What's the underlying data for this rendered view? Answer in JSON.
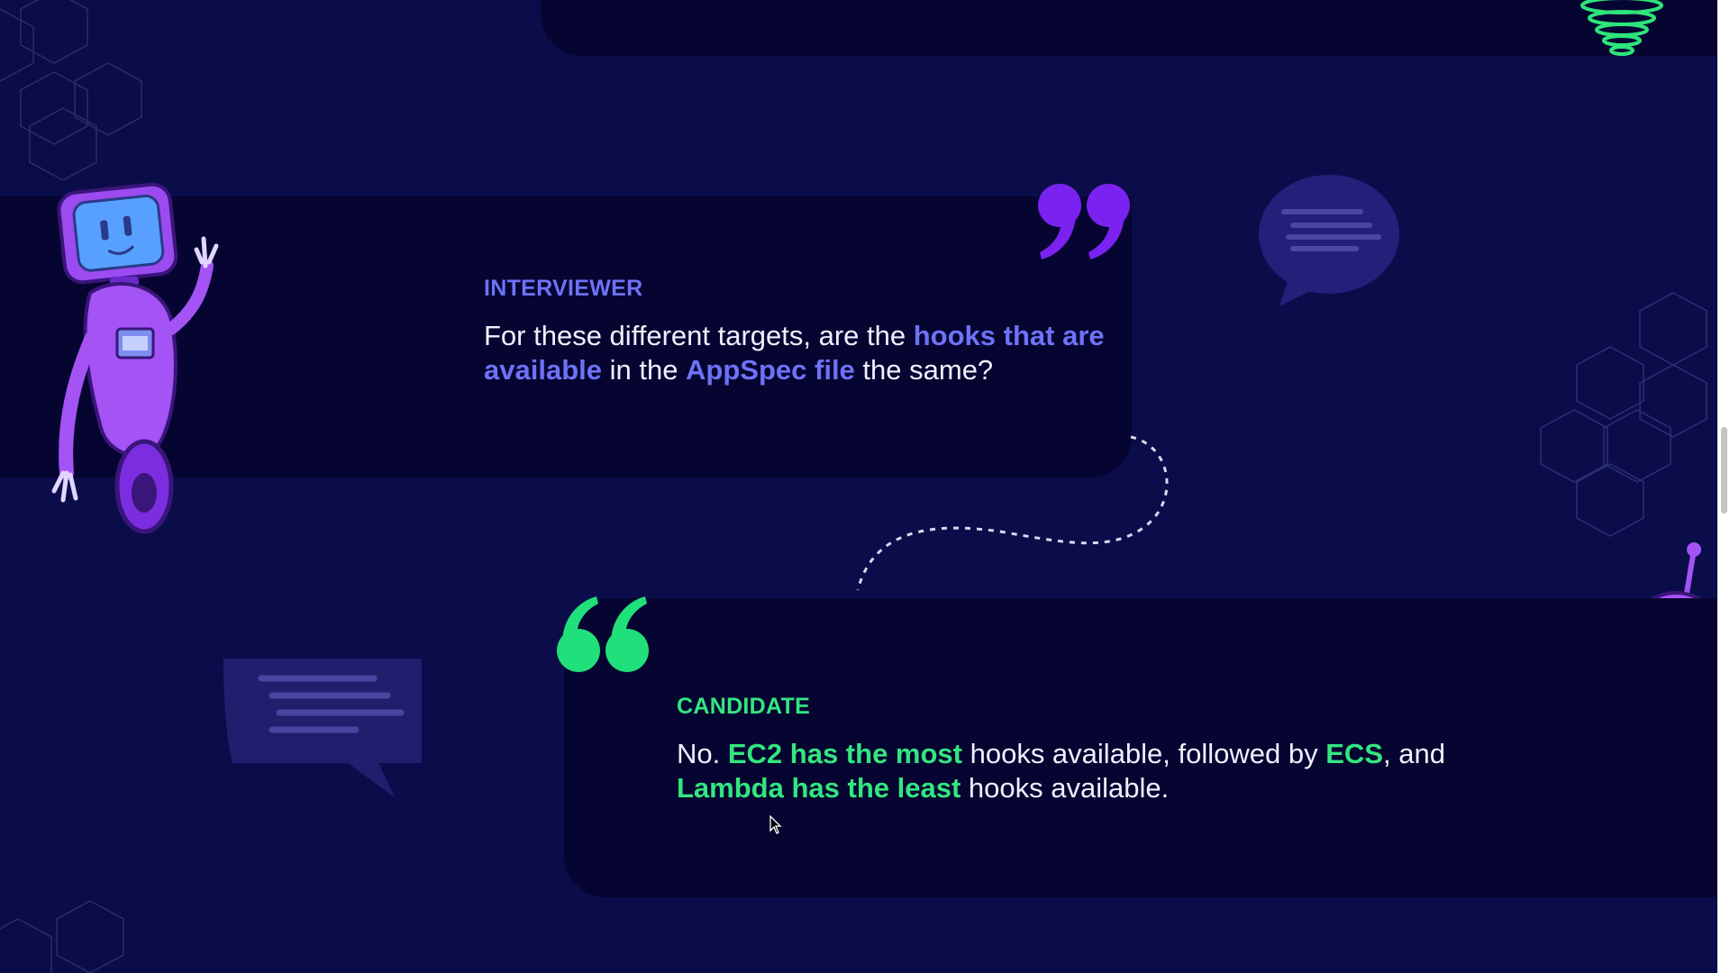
{
  "colors": {
    "background": "#0b0d4a",
    "card": "#060531",
    "interviewer_accent": "#6d72f6",
    "candidate_accent": "#33e67f",
    "quote_purple": "#7a22f0",
    "quote_green": "#1fe07a"
  },
  "interviewer": {
    "role": "INTERVIEWER",
    "text": {
      "p1": "For these different targets, are the ",
      "h1": "hooks that are available",
      "p2": " in the ",
      "h2": "AppSpec file",
      "p3": " the same?"
    }
  },
  "candidate": {
    "role": "CANDIDATE",
    "text": {
      "p1": "No. ",
      "h1": "EC2 has the most",
      "p2": " hooks available, followed by ",
      "h2": "ECS",
      "p3": ", and ",
      "h3": "Lambda has the least",
      "p4": " hooks available."
    }
  },
  "icons": {
    "closing_quote": "closing-quote-icon",
    "opening_quote": "opening-quote-icon",
    "robot_left": "robot-illustration",
    "robot_right": "robot-illustration",
    "speech_bubble": "speech-bubble-icon",
    "cursor": "mouse-cursor-icon"
  }
}
